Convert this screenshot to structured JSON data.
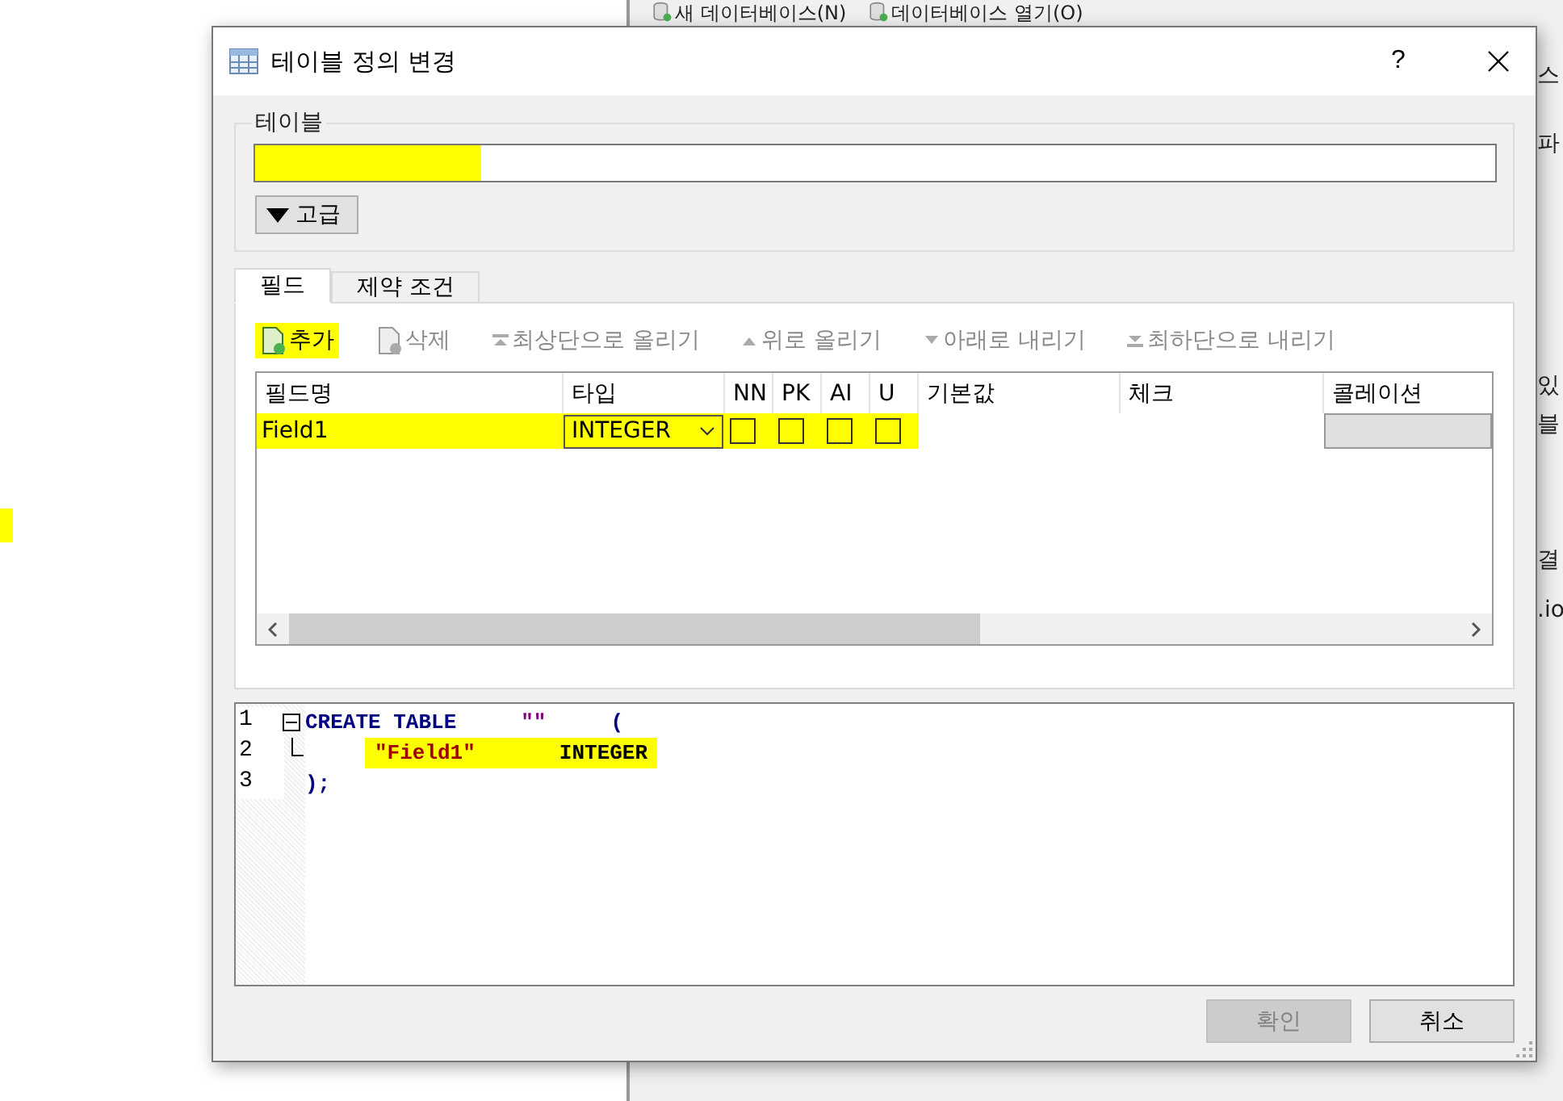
{
  "background_window": {
    "toolbar": [
      {
        "label": "새 데이터베이스(N)"
      },
      {
        "label": "데이터베이스 열기(O)"
      }
    ],
    "edge_fragments": [
      "스",
      "파",
      "있",
      "블",
      "결",
      ".io"
    ]
  },
  "dialog": {
    "title": "테이블 정의 변경",
    "help": "?",
    "table_group": {
      "legend": "테이블",
      "highlighted": true
    },
    "advanced_button": {
      "label": "고급",
      "expanded": false
    },
    "tabs": [
      {
        "label": "필드",
        "selected": true
      },
      {
        "label": "제약 조건",
        "selected": false
      }
    ],
    "toolbar": [
      {
        "label": "추가",
        "kind": "add",
        "disabled": false,
        "highlighted": true
      },
      {
        "label": "삭제",
        "kind": "delete",
        "disabled": true,
        "highlighted": false
      },
      {
        "label": "최상단으로 올리기",
        "kind": "top",
        "disabled": true,
        "highlighted": false
      },
      {
        "label": "위로 올리기",
        "kind": "up",
        "disabled": true,
        "highlighted": false
      },
      {
        "label": "아래로 내리기",
        "kind": "down",
        "disabled": true,
        "highlighted": false
      },
      {
        "label": "최하단으로 내리기",
        "kind": "bottom",
        "disabled": true,
        "highlighted": false
      }
    ],
    "columns": [
      "필드명",
      "타입",
      "NN",
      "PK",
      "AI",
      "U",
      "기본값",
      "체크",
      "콜레이션"
    ],
    "rows": [
      {
        "name": "Field1",
        "type": "INTEGER",
        "nn": false,
        "pk": false,
        "ai": false,
        "u": false,
        "highlighted": true
      }
    ],
    "sql": [
      {
        "number": "1",
        "fold_head": true,
        "fold_tail": false,
        "highlighted": false,
        "tokens": [
          {
            "text": "CREATE TABLE",
            "kind": "keyword"
          },
          {
            "text": "\"\"",
            "kind": "quote"
          },
          {
            "text": "(",
            "kind": "punct"
          }
        ]
      },
      {
        "number": "2",
        "fold_head": false,
        "fold_tail": true,
        "highlighted": true,
        "tokens": [
          {
            "text": "\"Field1\"",
            "kind": "string"
          },
          {
            "text": "INTEGER",
            "kind": "type"
          }
        ]
      },
      {
        "number": "3",
        "fold_head": false,
        "fold_tail": false,
        "highlighted": false,
        "tokens": [
          {
            "text": ");",
            "kind": "punct"
          }
        ]
      }
    ],
    "buttons": [
      {
        "label": "확인",
        "disabled": true
      },
      {
        "label": "취소",
        "disabled": false
      }
    ]
  }
}
